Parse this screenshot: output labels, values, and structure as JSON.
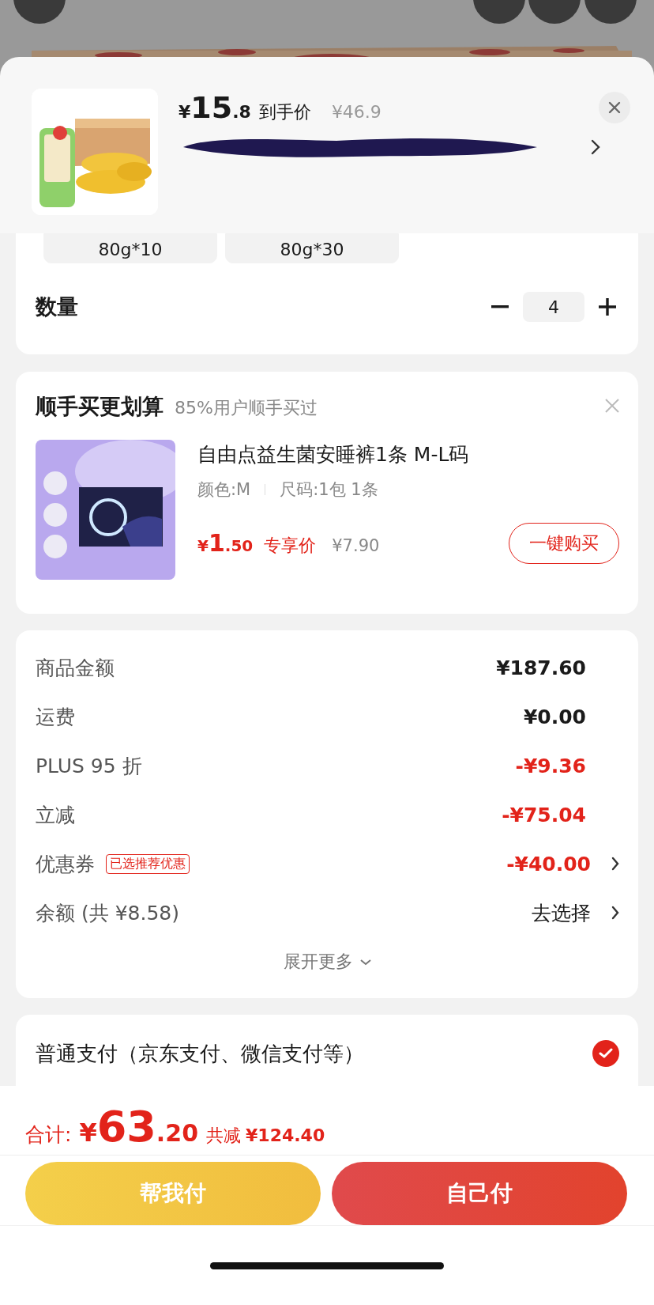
{
  "header": {
    "currency": "¥",
    "price_int": "15",
    "price_dec": ".8",
    "price_label": "到手价",
    "original_price": "¥46.9"
  },
  "specs": [
    {
      "label": "80g*10",
      "selected": false
    },
    {
      "label": "80g*30",
      "selected": false
    }
  ],
  "quantity": {
    "label": "数量",
    "value": "4"
  },
  "addon": {
    "title": "顺手买更划算",
    "subtitle": "85%用户顺手买过",
    "name": "自由点益生菌安睡裤1条 M-L码",
    "color_option": "颜色:M",
    "size": "尺码:1包 1条",
    "currency": "¥",
    "price_int": "1",
    "price_dec": ".50",
    "price_label": "专享价",
    "original_price": "¥7.90",
    "buy_button": "一键购买"
  },
  "summary": {
    "rows": [
      {
        "label": "商品金额",
        "value": "¥187.60",
        "kind": "plain",
        "chevron": false
      },
      {
        "label": "运费",
        "value": "¥0.00",
        "kind": "plain",
        "chevron": false
      },
      {
        "label": "PLUS 95 折",
        "value": "-¥9.36",
        "kind": "discount",
        "chevron": false
      },
      {
        "label": "立减",
        "value": "-¥75.04",
        "kind": "discount",
        "chevron": false
      },
      {
        "label": "优惠券",
        "tag": "已选推荐优惠",
        "value": "-¥40.00",
        "kind": "discount",
        "chevron": true
      },
      {
        "label": "余额 (共 ¥8.58)",
        "value": "去选择",
        "kind": "plain",
        "chevron": true
      }
    ],
    "expand": "展开更多"
  },
  "payment": {
    "label": "普通支付（京东支付、微信支付等）",
    "selected": true
  },
  "footer": {
    "total_label": "合计:",
    "currency": "¥",
    "total_int": "63",
    "total_dec": ".20",
    "saved_label": "共减",
    "saved": "¥124.40",
    "buttons": [
      {
        "label": "帮我付",
        "kind": "secondary"
      },
      {
        "label": "自己付",
        "kind": "primary"
      }
    ]
  }
}
